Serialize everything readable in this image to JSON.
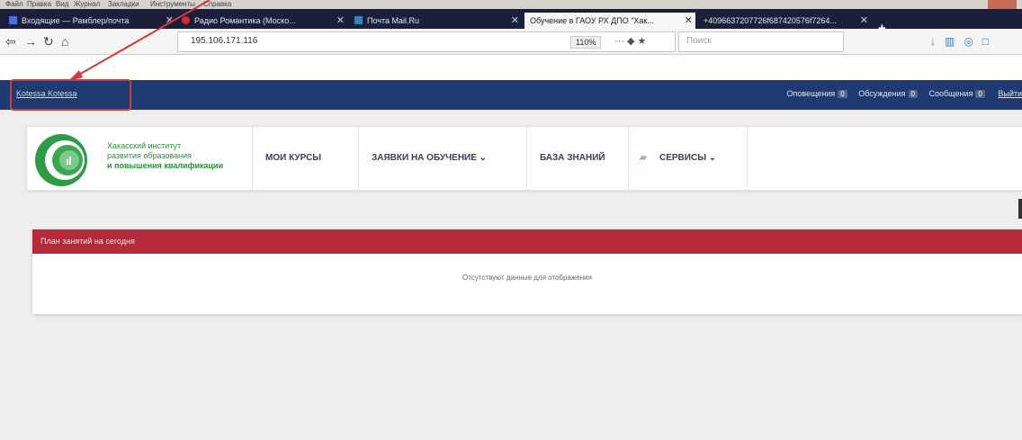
{
  "browser": {
    "menu": [
      "Файл",
      "Правка",
      "Вид",
      "Журнал",
      "Закладки",
      "Инструменты",
      "Справка"
    ],
    "tabs": [
      {
        "label": "Входящие — Рамблер/почта",
        "active": false
      },
      {
        "label": "Радио Романтика (Моско...",
        "active": false
      },
      {
        "label": "Почта Mail.Ru",
        "active": false
      },
      {
        "label": "Обучение в ГАОУ РХ ДПО \"Хак...",
        "active": true
      },
      {
        "label": "+4096637207726f687420576f7264...",
        "active": false
      }
    ],
    "url": "195.106.171.116",
    "zoom": "110%",
    "search_placeholder": "Поиск"
  },
  "site": {
    "username": "Kotessa Kotessa",
    "counts": [
      {
        "label": "Оповещения",
        "value": "0"
      },
      {
        "label": "Обсуждения",
        "value": "0"
      },
      {
        "label": "Сообщения",
        "value": "0"
      }
    ],
    "exit_label": "Выйти",
    "logo_text": {
      "line1": "Хакасский институт",
      "line2": "развития образования",
      "line3": "и повышения квалификации"
    },
    "nav": [
      {
        "label": "МОИ КУРСЫ"
      },
      {
        "label": "ЗАЯВКИ НА ОБУЧЕНИЕ ⌄"
      },
      {
        "label": "БАЗА ЗНАНИЙ"
      },
      {
        "label": "СЕРВИСЫ ⌄"
      }
    ],
    "panel": {
      "title": "План занятий на сегодня",
      "empty_text": "Отсутствуют данные для отображения"
    }
  },
  "colors": {
    "tabbar": "#1c1f3a",
    "sitebar": "#1e3a70",
    "panel_header": "#b52a3a",
    "annotation": "#d23a3a",
    "logo_green": "#2b8f3b"
  }
}
